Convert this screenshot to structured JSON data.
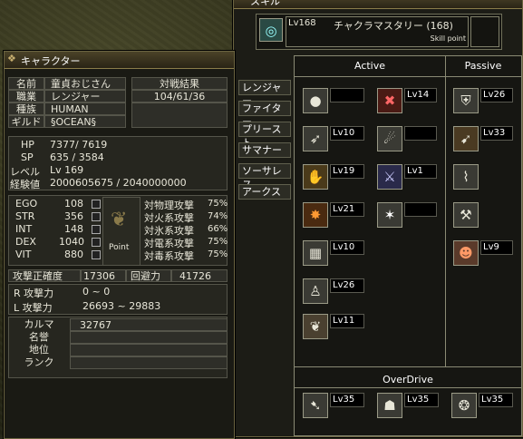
{
  "skill_window": {
    "title": "スキル",
    "selected": {
      "level": "Lv168",
      "name": "チャクラマスタリー (168)"
    },
    "skill_point_label": "Skill point",
    "active_label": "Active",
    "passive_label": "Passive",
    "overdrive_label": "OverDrive"
  },
  "class_tabs": [
    "レンジャー",
    "ファイター",
    "プリースト",
    "サマナー",
    "ソーサレス",
    "アークス"
  ],
  "skills": {
    "a1": "",
    "a2": "Lv10",
    "a3": "Lv19",
    "a4": "Lv21",
    "a5": "Lv10",
    "a6": "Lv26",
    "a7": "Lv11",
    "b1": "Lv14",
    "b2": "",
    "b3": "Lv1",
    "b4": "",
    "p1": "Lv26",
    "p2": "Lv33",
    "p3": "Lv9",
    "o1": "Lv35",
    "o2": "Lv35",
    "o3": "Lv35"
  },
  "character": {
    "title": "キャラクター",
    "labels": {
      "name": "名前",
      "job": "職業",
      "race": "種族",
      "guild": "ギルド",
      "battle": "対戦結果",
      "hp": "HP",
      "sp": "SP",
      "level": "レベル",
      "exp": "経験値",
      "point": "Point",
      "accuracy": "攻撃正確度",
      "evasion": "回避力",
      "r_attack": "R  攻撃力",
      "l_attack": "L  攻撃力",
      "karma": "カルマ",
      "fame": "名誉",
      "status": "地位",
      "rank": "ランク"
    },
    "name": "童貞おじさん",
    "job": "レンジャー",
    "race": "HUMAN",
    "guild": "§OCEAN§",
    "battle_result": "104/61/36",
    "hp": "7377/ 7619",
    "sp": "635 / 3584",
    "level": "Lv 169",
    "exp": "2000605675 / 2040000000",
    "accuracy": "17306",
    "evasion": "41726",
    "r_attack": "0 ~ 0",
    "l_attack": "26693 ~ 29883",
    "karma": "32767"
  },
  "stats": [
    {
      "label": "EGO",
      "value": "108"
    },
    {
      "label": "STR",
      "value": "356"
    },
    {
      "label": "INT",
      "value": "148"
    },
    {
      "label": "DEX",
      "value": "1040"
    },
    {
      "label": "VIT",
      "value": "880"
    }
  ],
  "resists": [
    {
      "label": "対物理攻撃",
      "value": "75%"
    },
    {
      "label": "対火系攻撃",
      "value": "74%"
    },
    {
      "label": "対氷系攻撃",
      "value": "66%"
    },
    {
      "label": "対電系攻撃",
      "value": "75%"
    },
    {
      "label": "対毒系攻撃",
      "value": "75%"
    }
  ]
}
